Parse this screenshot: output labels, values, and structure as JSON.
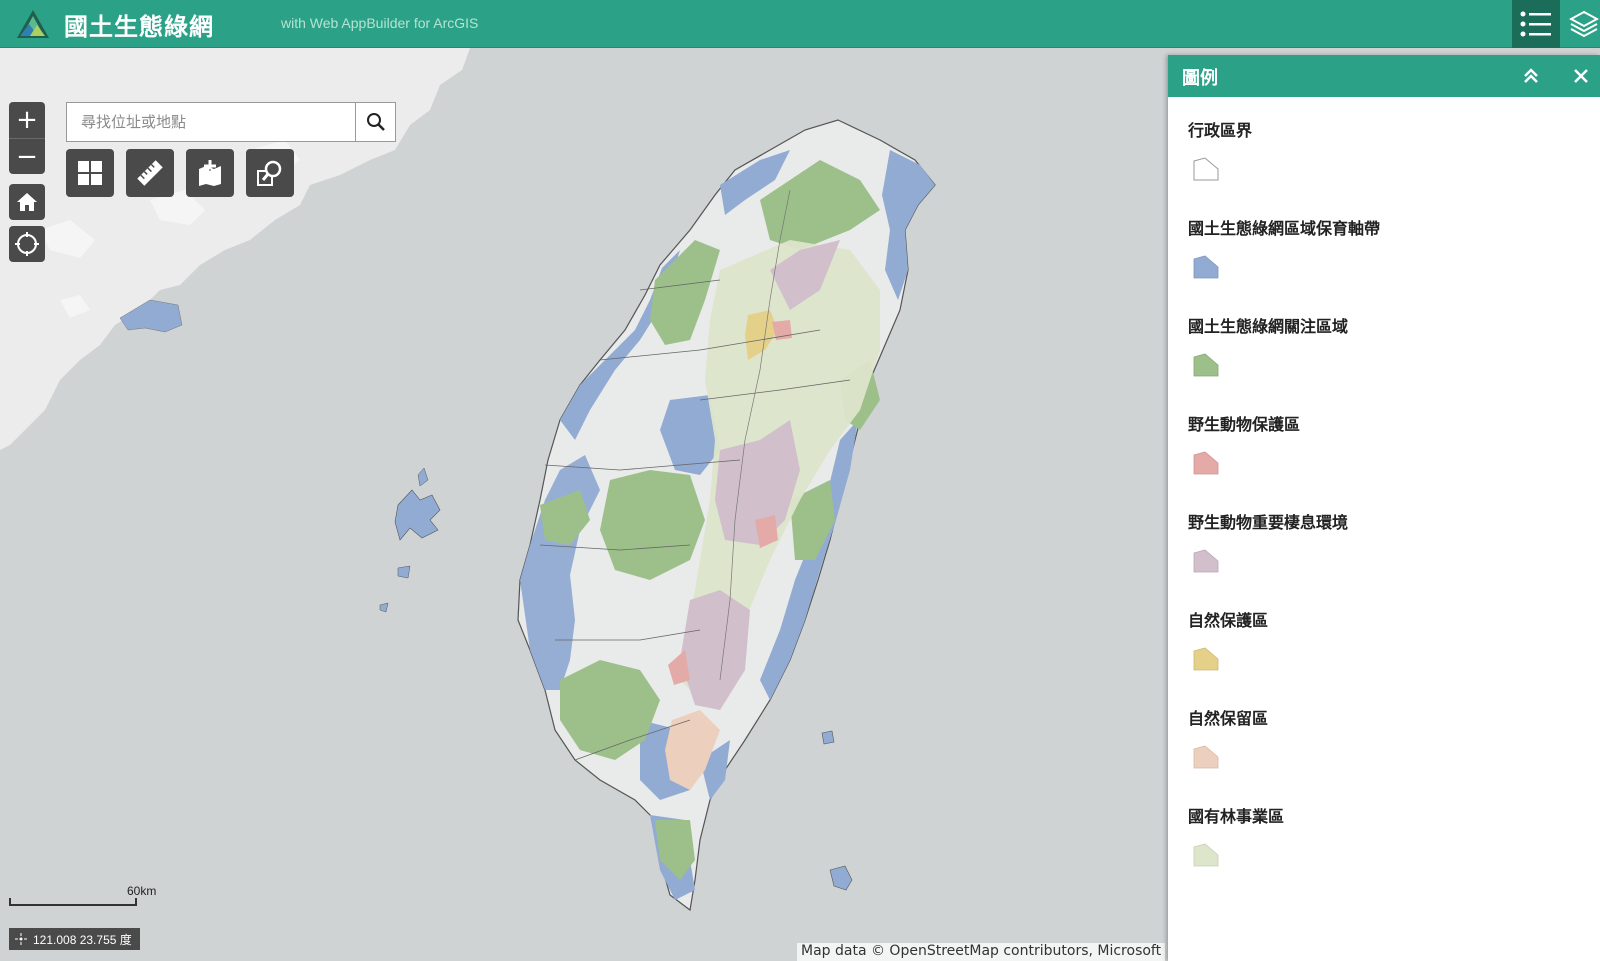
{
  "header": {
    "title": "國土生態綠網",
    "subtitle": "with Web AppBuilder for ArcGIS",
    "legend_icon": "list-icon",
    "layers_icon": "layers-icon"
  },
  "search": {
    "placeholder": "尋找位址或地點",
    "value": ""
  },
  "controls": {
    "zoom_in": "+",
    "zoom_out": "−"
  },
  "tools": [
    {
      "name": "basemap-gallery-icon"
    },
    {
      "name": "measurement-icon"
    },
    {
      "name": "add-data-icon"
    },
    {
      "name": "query-icon"
    }
  ],
  "map": {
    "scale_label": "60km",
    "coordinates": "121.008 23.755 度",
    "attribution": "Map data © OpenStreetMap contributors, Microsoft"
  },
  "legend_panel": {
    "title": "圖例",
    "items": [
      {
        "label": "行政區界",
        "color": "#ffffff"
      },
      {
        "label": "國土生態綠網區域保育軸帶",
        "color": "#91abd3"
      },
      {
        "label": "國土生態綠網關注區域",
        "color": "#9dc08a"
      },
      {
        "label": "野生動物保護區",
        "color": "#e3aaa7"
      },
      {
        "label": "野生動物重要棲息環境",
        "color": "#d1bfcb"
      },
      {
        "label": "自然保護區",
        "color": "#e5d08a"
      },
      {
        "label": "自然保留區",
        "color": "#edcfbe"
      },
      {
        "label": "國有林事業區",
        "color": "#dde5cb"
      }
    ]
  },
  "colors": {
    "header": "#2ba287",
    "map_water": "#cfd3d4",
    "land": "#e9eaea"
  }
}
